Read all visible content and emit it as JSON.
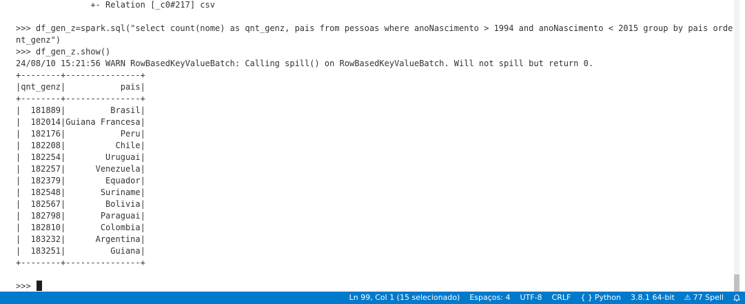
{
  "terminal": {
    "lines": [
      "               +- Relation [_c0#217] csv",
      "",
      ">>> df_gen_z=spark.sql(\"select count(nome) as qnt_genz, pais from pessoas where anoNascimento > 1994 and anoNascimento < 2015 group by pais order by q",
      "nt_genz\")",
      ">>> df_gen_z.show()",
      "24/08/10 15:21:56 WARN RowBasedKeyValueBatch: Calling spill() on RowBasedKeyValueBatch. Will not spill but return 0.",
      "+--------+---------------+",
      "|qnt_genz|           pais|",
      "+--------+---------------+",
      "|  181889|         Brasil|",
      "|  182014|Guiana Francesa|",
      "|  182176|           Peru|",
      "|  182208|          Chile|",
      "|  182254|        Uruguai|",
      "|  182257|      Venezuela|",
      "|  182379|        Equador|",
      "|  182548|       Suriname|",
      "|  182567|        Bolivia|",
      "|  182798|       Paraguai|",
      "|  182810|       Colombia|",
      "|  183232|      Argentina|",
      "|  183251|         Guiana|",
      "+--------+---------------+",
      ""
    ],
    "prompt": ">>>"
  },
  "status_bar": {
    "background": "#007acc",
    "items": {
      "position": "Ln 99, Col 1 (15 selecionado)",
      "indent": "Espaços: 4",
      "encoding": "UTF-8",
      "eol": "CRLF",
      "language_icon": "{ }",
      "language": "Python",
      "interpreter": "3.8.1 64-bit",
      "spell_icon": "⚠",
      "spell": "77 Spell"
    }
  }
}
